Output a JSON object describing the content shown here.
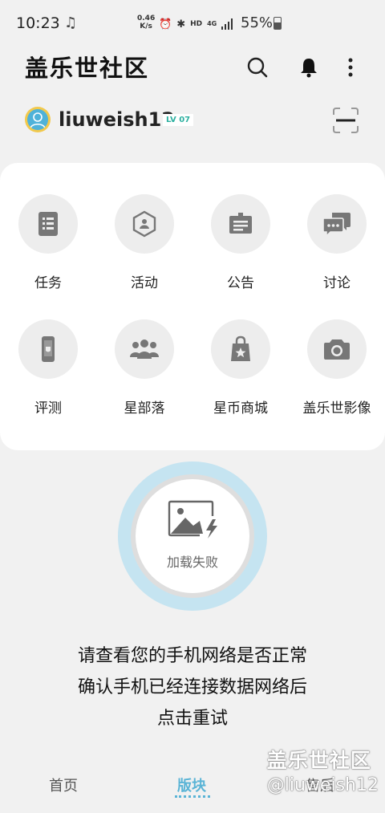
{
  "status_bar": {
    "time": "10:23",
    "speed_value": "0.46",
    "speed_unit": "K/s",
    "hd": "HD",
    "network": "4G",
    "battery_percent": "55%"
  },
  "header": {
    "title": "盖乐世社区",
    "icons": [
      "search-icon",
      "bell-icon",
      "more-vert-icon"
    ]
  },
  "user": {
    "name": "liuweish12",
    "level": "LV 07"
  },
  "grid": [
    {
      "label": "任务",
      "icon": "task-list-icon"
    },
    {
      "label": "活动",
      "icon": "event-hexagon-icon"
    },
    {
      "label": "公告",
      "icon": "announcement-board-icon"
    },
    {
      "label": "讨论",
      "icon": "discussion-chat-icon"
    },
    {
      "label": "评测",
      "icon": "phone-review-icon"
    },
    {
      "label": "星部落",
      "icon": "group-people-icon"
    },
    {
      "label": "星币商城",
      "icon": "shopping-bag-icon"
    },
    {
      "label": "盖乐世影像",
      "icon": "camera-icon"
    }
  ],
  "error": {
    "image_text": "加载失败",
    "lines": [
      "请查看您的手机网络是否正常",
      "确认手机已经连接数据网络后",
      "点击重试"
    ]
  },
  "nav": {
    "items": [
      "首页",
      "版块",
      "售后"
    ],
    "active": "版块",
    "active_color": "#5ab4d6"
  },
  "watermark": {
    "title": "盖乐世社区",
    "user": "@liuweish12"
  }
}
